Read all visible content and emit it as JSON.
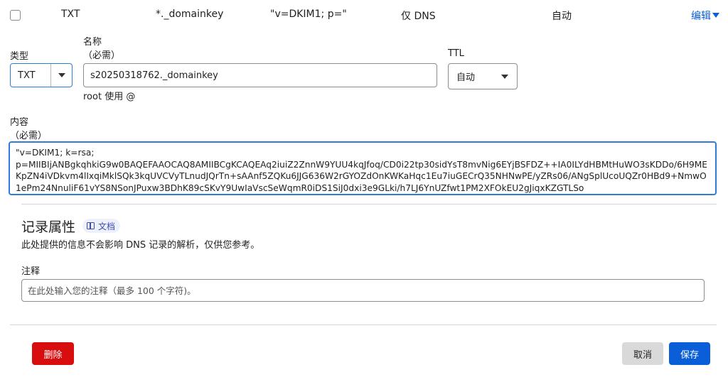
{
  "record_row": {
    "type": "TXT",
    "name": "*._domainkey",
    "content": "\"v=DKIM1; p=\"",
    "proxy_status": "仅 DNS",
    "ttl": "自动",
    "edit_label": "编辑"
  },
  "form": {
    "type_label": "类型",
    "type_value": "TXT",
    "name_label": "名称",
    "name_required": "（必需）",
    "name_value": "s20250318762._domainkey",
    "name_hint": "root 使用 @",
    "ttl_label": "TTL",
    "ttl_value": "自动",
    "content_label": "内容",
    "content_required": "（必需）",
    "content_value": "\"v=DKIM1; k=rsa;\np=MIIBIjANBgkqhkiG9w0BAQEFAAOCAQ8AMIIBCgKCAQEAq2iuiZ2ZnnW9YUU4kqJfoq/CD0i22tp30sidYsT8mvNig6EYjBSFDZ++IA0ILYdHBMtHuWO3sKDDo/6H9MEKpZN4iVDkvm4lIxqiMklSQk3kqUVCVyTLnudJQrTn+sAAnf5ZQKu6JJG636W2rGYOZdOnKWKaHqc1Eu7iuGECrQ35NHNwPE/yZRs06/ANgSplUcoUQZr0HBd9+NmwO1ePm24NnuliF61vYS8NSonJPuxw3BDhK89cSKvY9UwIaVscSeWqmR0iDS1SiJ0dxi3e9GLki/h7LJ6YnUZfwt1PM2XFOkEU2gJiqxKZGTLSo"
  },
  "attributes": {
    "title": "记录属性",
    "doc_label": "文档",
    "description": "此处提供的信息不会影响 DNS 记录的解析，仅供您参考。",
    "notes_label": "注释",
    "notes_placeholder": "在此处输入您的注释（最多 100 个字符)。",
    "notes_value": ""
  },
  "actions": {
    "delete_label": "删除",
    "cancel_label": "取消",
    "save_label": "保存"
  },
  "colors": {
    "accent": "#0a5ed7",
    "danger": "#d80d0d",
    "focus_border": "#2f7bd8",
    "neutral_button": "#d9d9d9"
  }
}
